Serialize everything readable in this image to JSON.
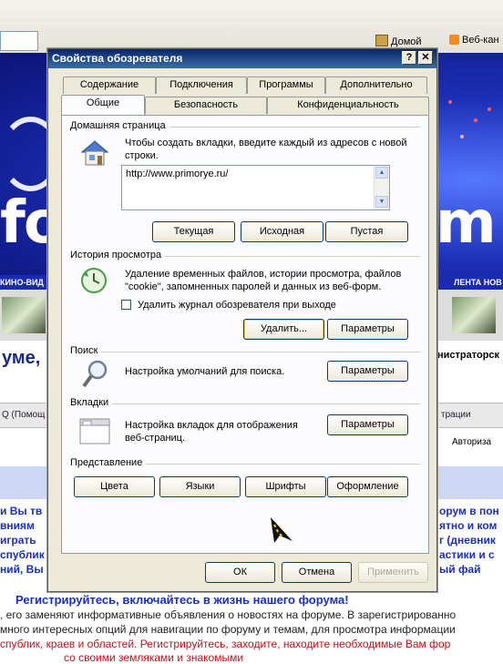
{
  "background_page": {
    "toolbar": {
      "home_label": "Домой",
      "feeds_label": "Веб-кан"
    },
    "strip": {
      "left": "КИНО-ВИД",
      "right": "ЛЕНТА НОВ"
    },
    "title_left": "уме, г",
    "title_right": "нистраторск",
    "row1": {
      "left": "Q (Помощ",
      "right": "трации"
    },
    "row2": {
      "right": "Авториза"
    },
    "lines_left": [
      "и Вы тв",
      "вниям",
      "играть",
      "спублик",
      "ний, Вы"
    ],
    "lines_right": [
      "орум в пон",
      "ятно и ком",
      "г (дневник",
      "астики и с",
      "ый фай"
    ],
    "cta": "Регистрируйтесь, включайтесь в жизнь нашего форума!",
    "para1": ", его заменяют информативные объявления о новостях на форуме. В зарегистрированно",
    "para2": "много интересных опций для навигации по форуму и темам, для просмотра информации",
    "para3": "спублик, краев и областей. Регистрируйтесь, заходите, находите необходимые Вам фор",
    "para4": "со своими земляками и знакомыми"
  },
  "dialog": {
    "title": "Свойства обозревателя",
    "help_button": "?",
    "close_button": "✕",
    "tabs_row1": [
      "Содержание",
      "Подключения",
      "Программы",
      "Дополнительно"
    ],
    "tabs_row2": [
      "Общие",
      "Безопасность",
      "Конфиденциальность"
    ],
    "active_tab": "Общие",
    "home_page": {
      "label": "Домашняя страница",
      "description": "Чтобы создать вкладки, введите каждый из адресов с новой строки.",
      "url": "http://www.primorye.ru/",
      "buttons": [
        "Текущая",
        "Исходная",
        "Пустая"
      ]
    },
    "history": {
      "label": "История просмотра",
      "description": "Удаление временных файлов, истории просмотра, файлов \"cookie\", запомненных паролей и данных из веб-форм.",
      "checkbox_label": "Удалить журнал обозревателя при выходе",
      "checkbox_checked": false,
      "delete_button": "Удалить...",
      "settings_button": "Параметры"
    },
    "search": {
      "label": "Поиск",
      "description": "Настройка умолчаний для поиска.",
      "settings_button": "Параметры"
    },
    "tabs_section": {
      "label": "Вкладки",
      "description": "Настройка вкладок для отображения веб-страниц.",
      "settings_button": "Параметры"
    },
    "appearance": {
      "label": "Представление",
      "buttons": [
        "Цвета",
        "Языки",
        "Шрифты",
        "Оформление"
      ]
    },
    "footer": {
      "ok": "ОК",
      "cancel": "Отмена",
      "apply": "Применить"
    }
  }
}
